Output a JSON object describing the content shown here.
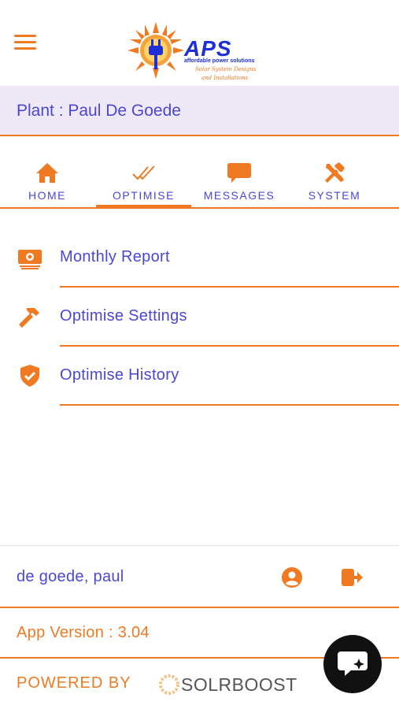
{
  "header": {
    "menu_icon": "hamburger-menu-icon",
    "logo": {
      "brand": "APS",
      "tagline": "affordable power solutions",
      "script_line1": "Solar System Designs",
      "script_line2": "and Installations"
    }
  },
  "plant": {
    "label": "Plant : Paul De Goede"
  },
  "tabs": [
    {
      "label": "HOME",
      "icon": "home-icon",
      "active": false
    },
    {
      "label": "OPTIMISE",
      "icon": "double-check-icon",
      "active": true
    },
    {
      "label": "MESSAGES",
      "icon": "chat-bubble-icon",
      "active": false
    },
    {
      "label": "SYSTEM",
      "icon": "tools-icon",
      "active": false
    }
  ],
  "menu": [
    {
      "label": "Monthly Report",
      "icon": "money-icon"
    },
    {
      "label": "Optimise Settings",
      "icon": "hammer-icon"
    },
    {
      "label": "Optimise History",
      "icon": "shield-check-icon"
    }
  ],
  "user": {
    "name": "de goede, paul",
    "profile_icon": "account-circle-icon",
    "logout_icon": "logout-icon"
  },
  "version": {
    "label": "App Version : 3.04"
  },
  "footer": {
    "powered_by": "POWERED BY",
    "brand": "SOLRBOOST"
  },
  "chat": {
    "icon": "chat-sparkle-icon"
  },
  "colors": {
    "accent": "#f07a22",
    "primary_text": "#4b47d6",
    "plant_bar_bg": "#efe9f7"
  }
}
